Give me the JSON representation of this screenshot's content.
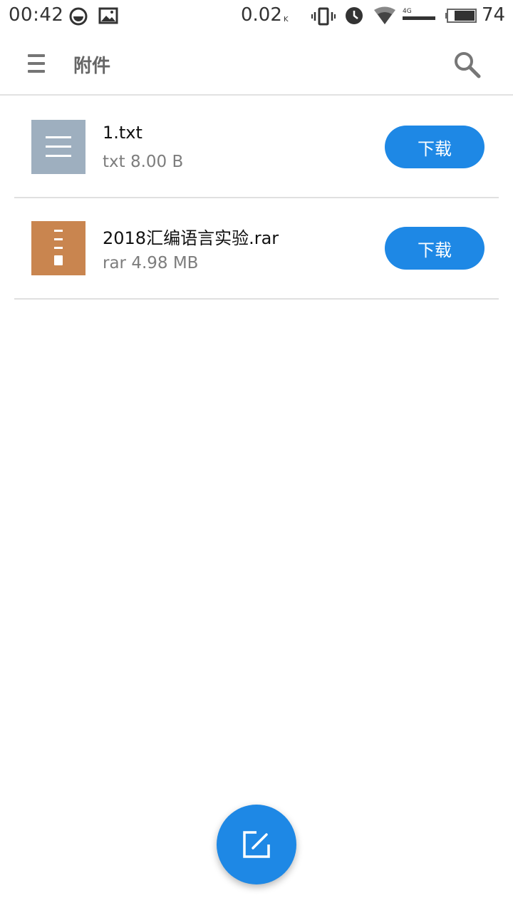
{
  "status_bar": {
    "time": "00:42",
    "network_speed": "0.02",
    "network_speed_unit": "K",
    "signal_type": "4G",
    "battery_level": "74",
    "icons": [
      "messenger-icon",
      "image-icon",
      "vibrate-icon",
      "alarm-icon",
      "wifi-icon",
      "cellular-signal-icon",
      "battery-icon"
    ]
  },
  "app_bar": {
    "title": "附件",
    "menu_icon": "hamburger-menu-icon",
    "search_icon": "search-icon"
  },
  "attachments": [
    {
      "name": "1.txt",
      "type": "txt",
      "size": "8.00 B",
      "meta": "txt 8.00 B",
      "download_label": "下载",
      "thumb_color": "#9eafbf",
      "icon": "text-file-icon"
    },
    {
      "name": "2018汇编语言实验.rar",
      "type": "rar",
      "size": "4.98 MB",
      "meta": "rar 4.98 MB",
      "download_label": "下载",
      "thumb_color": "#c9854f",
      "icon": "archive-file-icon"
    }
  ],
  "fab": {
    "icon": "compose-icon"
  },
  "colors": {
    "accent": "#1e88e5",
    "divider": "#e0e0e0"
  }
}
